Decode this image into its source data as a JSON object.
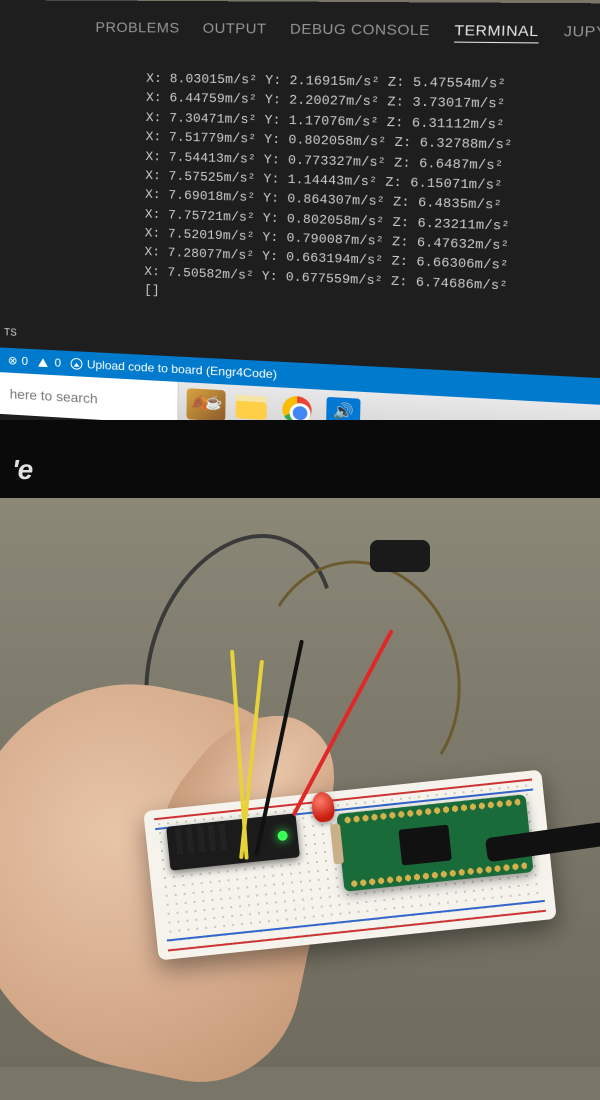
{
  "tabs": {
    "problems": "PROBLEMS",
    "output": "OUTPUT",
    "debug_console": "DEBUG CONSOLE",
    "terminal": "TERMINAL",
    "jupyter": "JUPY"
  },
  "readings": [
    {
      "x": "8.03015",
      "y": "2.16915",
      "z": "5.47554"
    },
    {
      "x": "6.44759",
      "y": "2.20027",
      "z": "3.73017"
    },
    {
      "x": "7.30471",
      "y": "1.17076",
      "z": "6.31112"
    },
    {
      "x": "7.51779",
      "y": "0.802058",
      "z": "6.32788"
    },
    {
      "x": "7.54413",
      "y": "0.773327",
      "z": "6.6487"
    },
    {
      "x": "7.57525",
      "y": "1.14443",
      "z": "6.15071"
    },
    {
      "x": "7.69018",
      "y": "0.864307",
      "z": "6.4835"
    },
    {
      "x": "7.75721",
      "y": "0.802058",
      "z": "6.23211"
    },
    {
      "x": "7.52019",
      "y": "0.790087",
      "z": "6.47632"
    },
    {
      "x": "7.28077",
      "y": "0.663194",
      "z": "6.66306"
    },
    {
      "x": "7.50582",
      "y": "0.677559",
      "z": "6.74686"
    }
  ],
  "unit": "m/s²",
  "cursor_glyph": "[]",
  "panel_label": "TS",
  "status": {
    "errors": "0",
    "warnings": "0",
    "upload_text": "Upload code to board (Engr4Code)"
  },
  "taskbar": {
    "search_placeholder": "here to search"
  },
  "monitor_brand_fragment": "'e",
  "hardware": {
    "microcontroller": "Raspberry Pi Pico",
    "sensor_module": "accelerometer breakout",
    "indicator_led": "red LED",
    "power_led": "green status LED",
    "platform": "solderless breadboard",
    "jumper_colors": [
      "red",
      "black",
      "yellow",
      "yellow",
      "brown"
    ]
  }
}
